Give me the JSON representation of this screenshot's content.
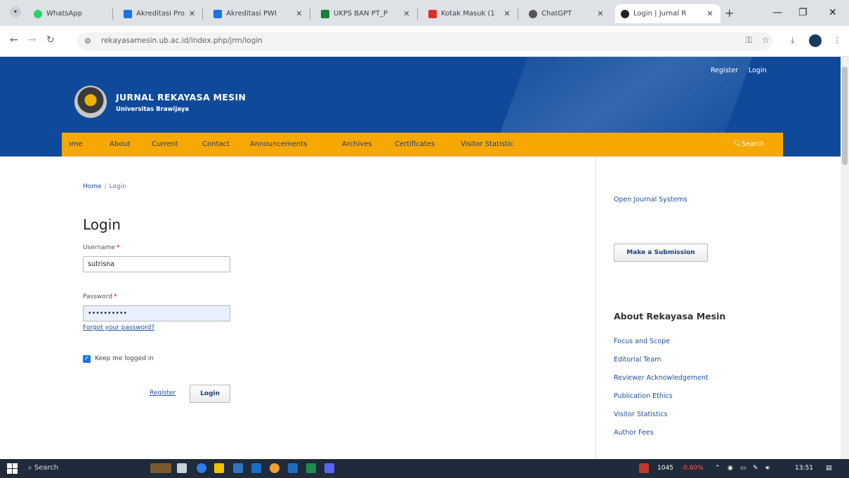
{
  "browser": {
    "tabs": [
      {
        "title": "WhatsApp",
        "color": "#25d366"
      },
      {
        "title": "Akreditasi Prod",
        "color": "#1a73e8"
      },
      {
        "title": "Akreditasi PWI",
        "color": "#1a73e8"
      },
      {
        "title": "UKPS BAN PT_P",
        "color": "#188038"
      },
      {
        "title": "Kotak Masuk (1",
        "color": "#d93025"
      },
      {
        "title": "ChatGPT",
        "color": "#555555"
      },
      {
        "title": "Login | Jurnal R",
        "color": "#222222"
      }
    ],
    "url": "rekayasamesin.ub.ac.id/index.php/jrm/login"
  },
  "site": {
    "title": "JURNAL REKAYASA MESIN",
    "subtitle": "Universitas Brawijaya",
    "header_links": {
      "register": "Register",
      "login": "Login"
    },
    "nav": [
      "Home",
      "About",
      "Current",
      "Contact",
      "Announcements",
      "Archives",
      "Certificates",
      "Visitor Statistic"
    ],
    "search_label": "Search"
  },
  "content": {
    "breadcrumb": {
      "home": "Home",
      "sep": "/",
      "current": "Login"
    },
    "page_title": "Login",
    "username_label": "Username",
    "username_value": "sutrisna",
    "password_label": "Password",
    "password_value": "••••••••••",
    "required_mark": "*",
    "forgot_password": "Forgot your password?",
    "keep_logged_in": "Keep me logged in",
    "register_link": "Register",
    "login_button": "Login"
  },
  "sidebar": {
    "ojs_link": "Open Journal Systems",
    "submit_button": "Make a Submission",
    "about_title": "About Rekayasa Mesin",
    "about_links": [
      "Focus and Scope",
      "Editorial Team",
      "Reviewer Acknowledgement",
      "Publication Ethics",
      "Visitor Statistics",
      "Author Fees"
    ]
  },
  "taskbar": {
    "search_placeholder": "Search",
    "stock_value": "1045",
    "stock_change": "-0.60%",
    "time": "13:51"
  },
  "colors": {
    "header_blue": "#0f4a9a",
    "nav_orange": "#f7a800"
  }
}
